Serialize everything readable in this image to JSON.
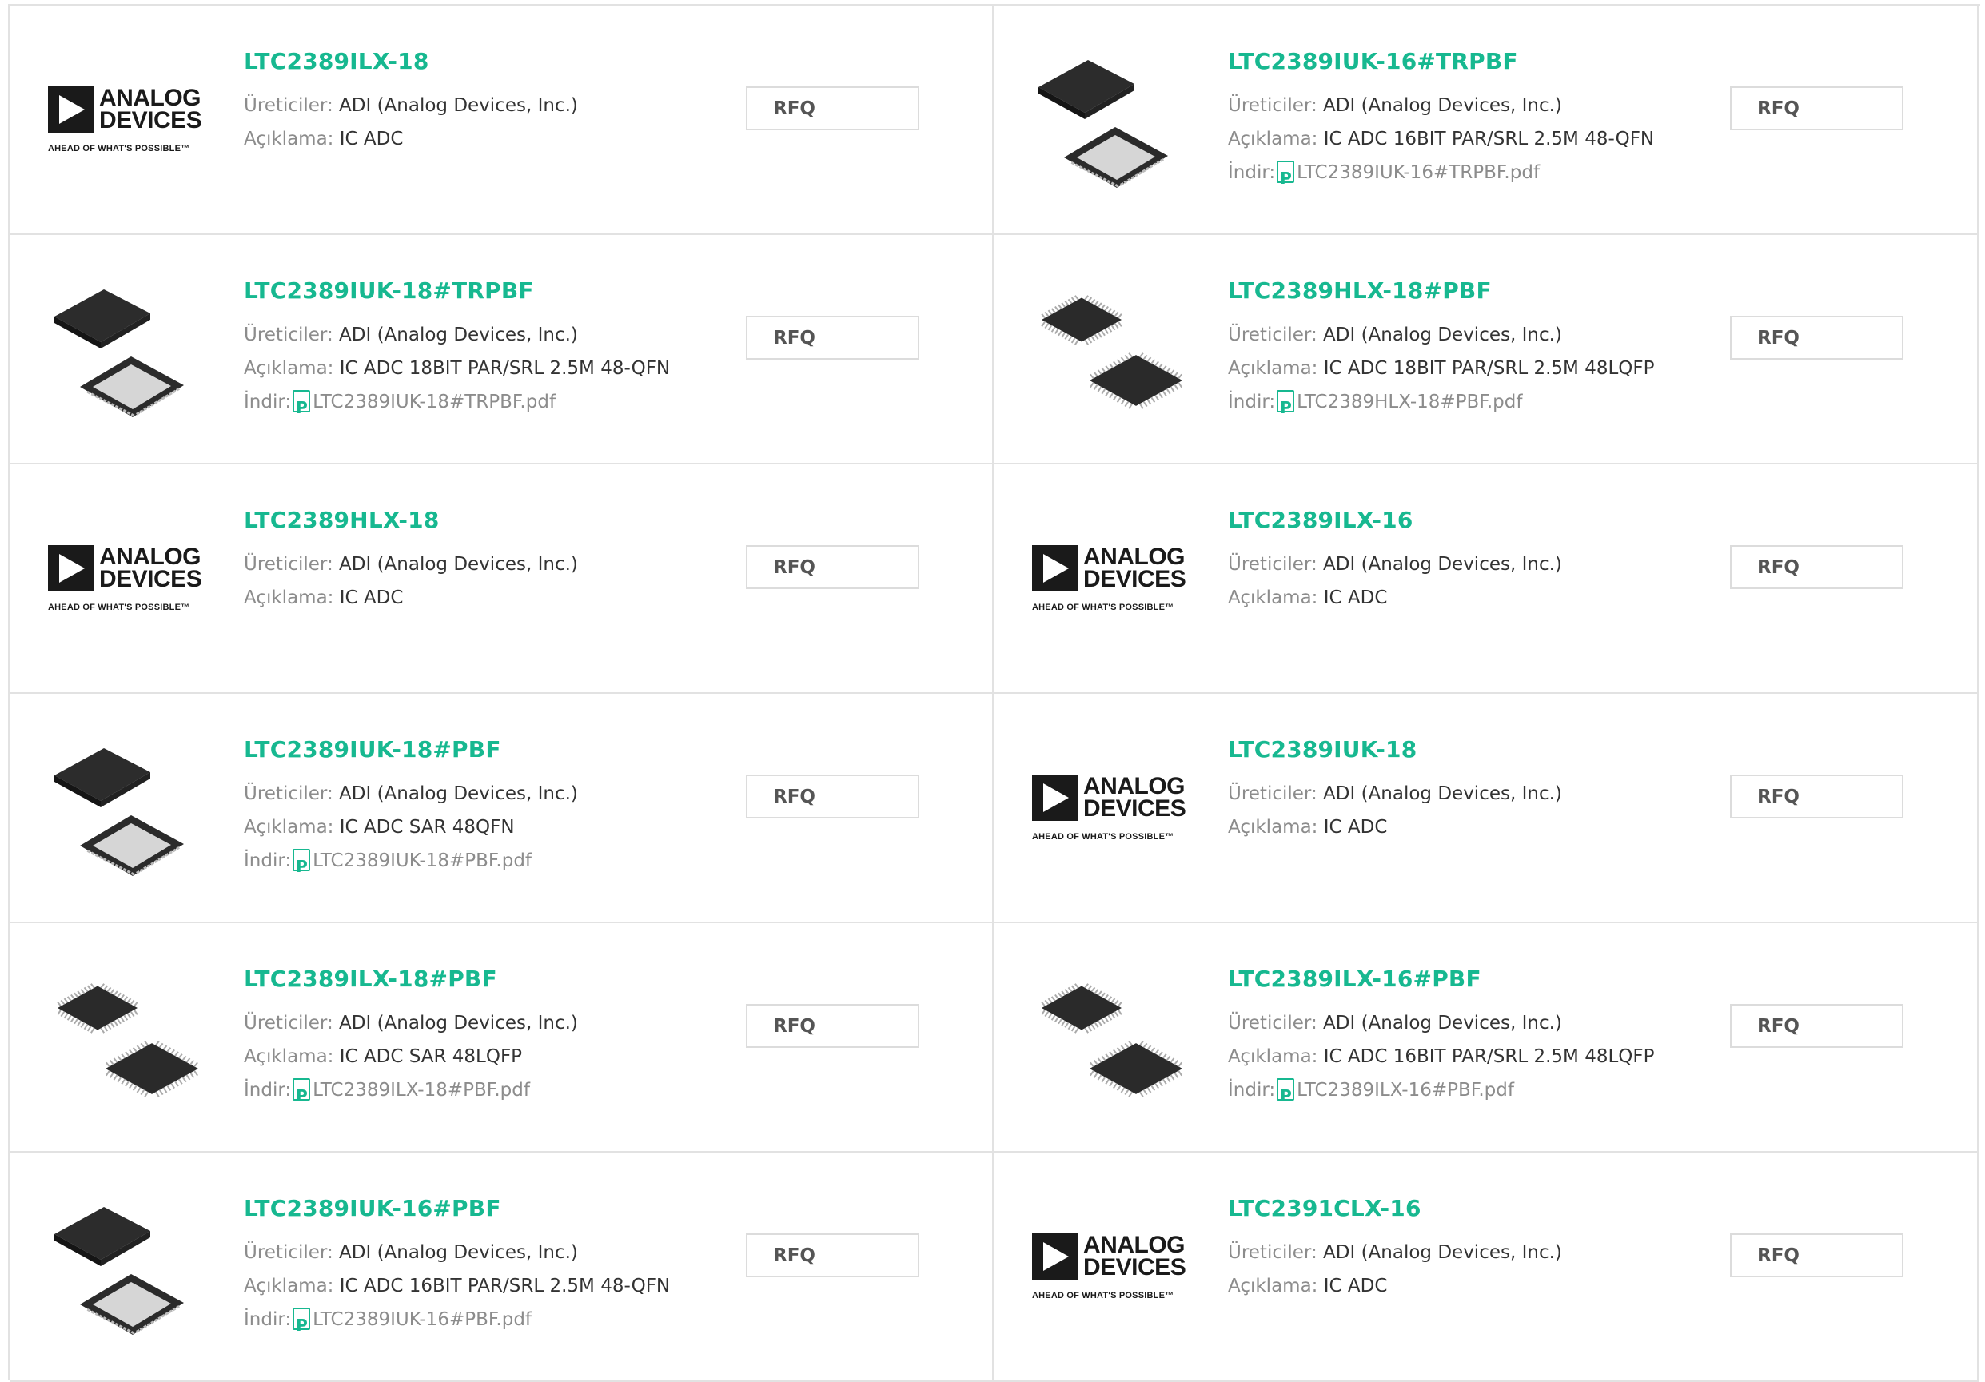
{
  "labels": {
    "manufacturer": "Üreticiler:",
    "description": "Açıklama:",
    "download": "İndir:",
    "rfq": "RFQ"
  },
  "logo": {
    "line1": "ANALOG",
    "line2": "DEVICES",
    "tagline": "AHEAD OF WHAT'S POSSIBLE™"
  },
  "colors": {
    "accent": "#17b890",
    "border": "#e2e2e2"
  },
  "products": [
    {
      "name": "LTC2389ILX-18",
      "manufacturer": "ADI (Analog Devices, Inc.)",
      "description": "IC ADC",
      "pdf": "",
      "image": "adi-logo"
    },
    {
      "name": "LTC2389IUK-16#TRPBF",
      "manufacturer": "ADI (Analog Devices, Inc.)",
      "description": "IC ADC 16BIT PAR/SRL 2.5M 48-QFN",
      "pdf": "LTC2389IUK-16#TRPBF.pdf",
      "image": "qfn-chip"
    },
    {
      "name": "LTC2389IUK-18#TRPBF",
      "manufacturer": "ADI (Analog Devices, Inc.)",
      "description": "IC ADC 18BIT PAR/SRL 2.5M 48-QFN",
      "pdf": "LTC2389IUK-18#TRPBF.pdf",
      "image": "qfn-chip"
    },
    {
      "name": "LTC2389HLX-18#PBF",
      "manufacturer": "ADI (Analog Devices, Inc.)",
      "description": "IC ADC 18BIT PAR/SRL 2.5M 48LQFP",
      "pdf": "LTC2389HLX-18#PBF.pdf",
      "image": "lqfp-chip"
    },
    {
      "name": "LTC2389HLX-18",
      "manufacturer": "ADI (Analog Devices, Inc.)",
      "description": "IC ADC",
      "pdf": "",
      "image": "adi-logo"
    },
    {
      "name": "LTC2389ILX-16",
      "manufacturer": "ADI (Analog Devices, Inc.)",
      "description": "IC ADC",
      "pdf": "",
      "image": "adi-logo"
    },
    {
      "name": "LTC2389IUK-18#PBF",
      "manufacturer": "ADI (Analog Devices, Inc.)",
      "description": "IC ADC SAR 48QFN",
      "pdf": "LTC2389IUK-18#PBF.pdf",
      "image": "qfn-chip"
    },
    {
      "name": "LTC2389IUK-18",
      "manufacturer": "ADI (Analog Devices, Inc.)",
      "description": "IC ADC",
      "pdf": "",
      "image": "adi-logo"
    },
    {
      "name": "LTC2389ILX-18#PBF",
      "manufacturer": "ADI (Analog Devices, Inc.)",
      "description": "IC ADC SAR 48LQFP",
      "pdf": "LTC2389ILX-18#PBF.pdf",
      "image": "lqfp-chip"
    },
    {
      "name": "LTC2389ILX-16#PBF",
      "manufacturer": "ADI (Analog Devices, Inc.)",
      "description": "IC ADC 16BIT PAR/SRL 2.5M 48LQFP",
      "pdf": "LTC2389ILX-16#PBF.pdf",
      "image": "lqfp-chip"
    },
    {
      "name": "LTC2389IUK-16#PBF",
      "manufacturer": "ADI (Analog Devices, Inc.)",
      "description": "IC ADC 16BIT PAR/SRL 2.5M 48-QFN",
      "pdf": "LTC2389IUK-16#PBF.pdf",
      "image": "qfn-chip"
    },
    {
      "name": "LTC2391CLX-16",
      "manufacturer": "ADI (Analog Devices, Inc.)",
      "description": "IC ADC",
      "pdf": "",
      "image": "adi-logo"
    }
  ]
}
